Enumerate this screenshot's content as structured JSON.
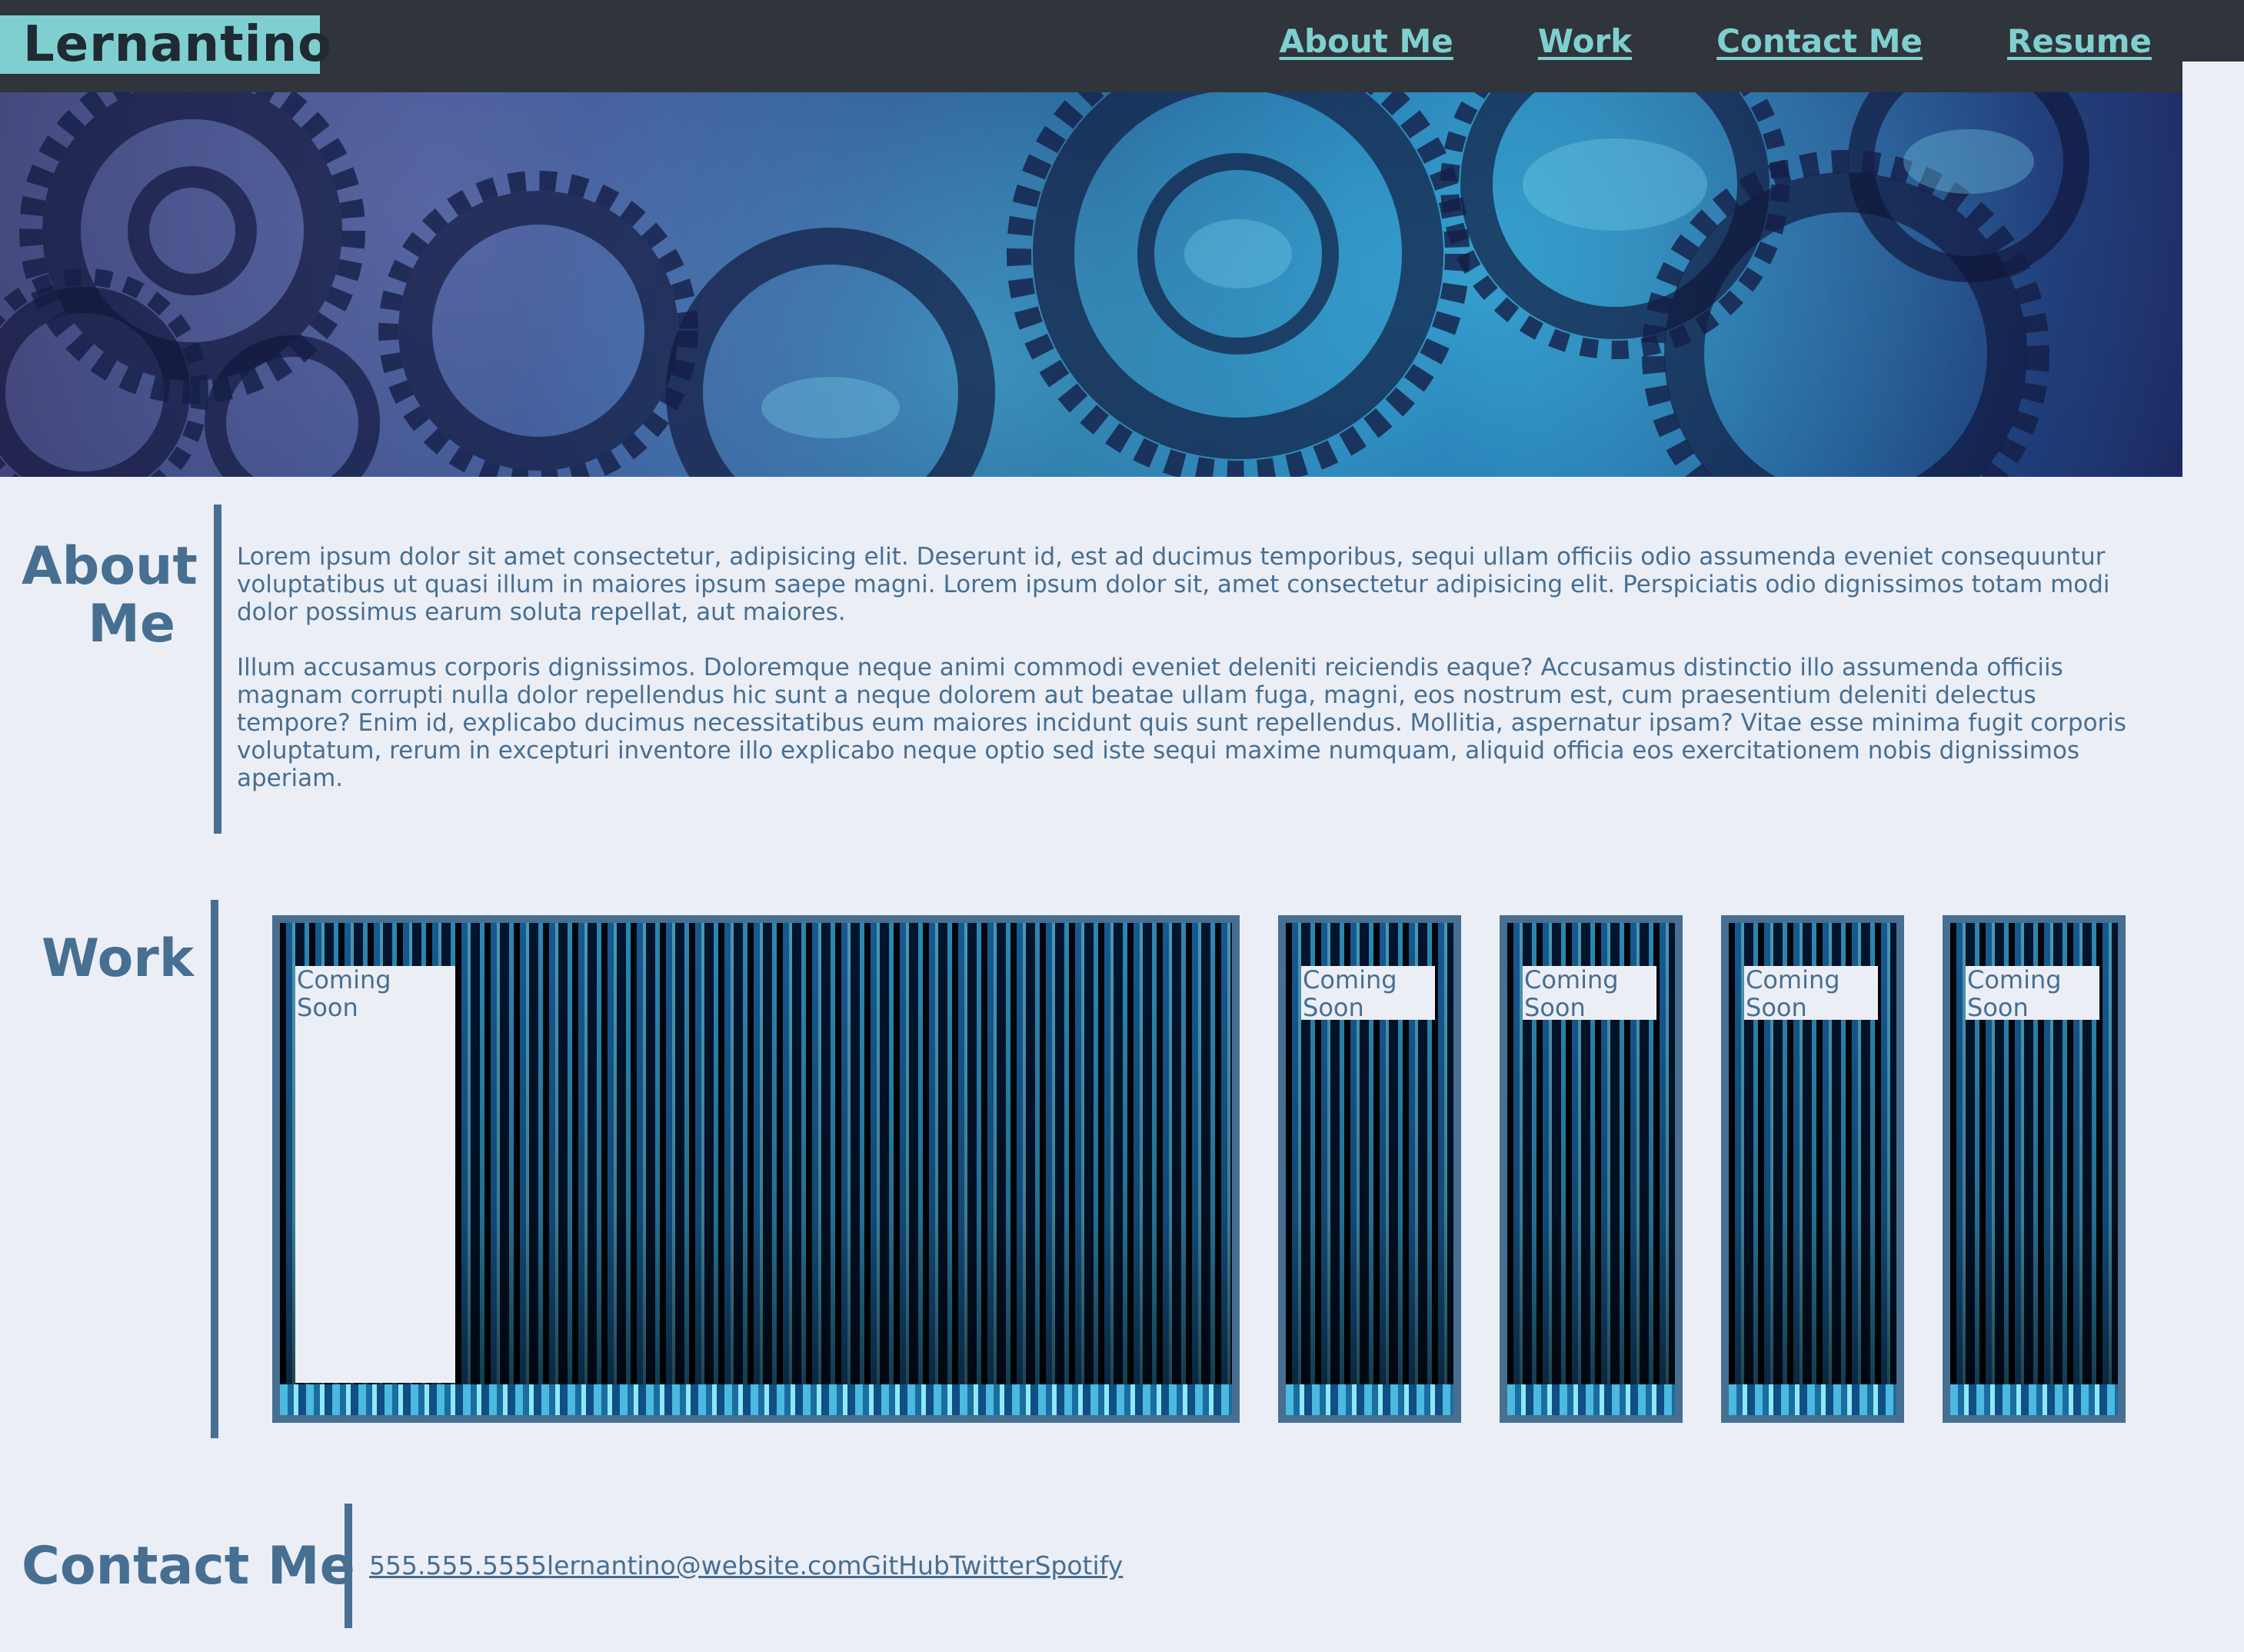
{
  "header": {
    "brand": "Lernantino",
    "nav": [
      "About Me",
      "Work",
      "Contact Me",
      "Resume"
    ]
  },
  "about": {
    "title": "About Me",
    "paragraphs": [
      "Lorem ipsum dolor sit amet consectetur, adipisicing elit. Deserunt id, est ad ducimus temporibus, sequi ullam officiis odio assumenda eveniet consequuntur voluptatibus ut quasi illum in maiores ipsum saepe magni. Lorem ipsum dolor sit, amet consectetur adipisicing elit. Perspiciatis odio dignissimos totam modi dolor possimus earum soluta repellat, aut maiores.",
      "Illum accusamus corporis dignissimos. Doloremque neque animi commodi eveniet deleniti reiciendis eaque? Accusamus distinctio illo assumenda officiis magnam corrupti nulla dolor repellendus hic sunt a neque dolorem aut beatae ullam fuga, magni, eos nostrum est, cum praesentium deleniti delectus tempore? Enim id, explicabo ducimus necessitatibus eum maiores incidunt quis sunt repellendus. Mollitia, aspernatur ipsam? Vitae esse minima fugit corporis voluptatum, rerum in excepturi inventore illo explicabo neque optio sed iste sequi maxime numquam, aliquid officia eos exercitationem nobis dignissimos aperiam."
    ]
  },
  "work": {
    "title": "Work",
    "items": [
      {
        "label": "Coming Soon"
      },
      {
        "label": "Coming Soon"
      },
      {
        "label": "Coming Soon"
      },
      {
        "label": "Coming Soon"
      },
      {
        "label": "Coming Soon"
      }
    ]
  },
  "contact": {
    "title": "Contact Me",
    "links": [
      "555.555.5555",
      "lernantino@website.com",
      "GitHub",
      "Twitter",
      "Spotify"
    ]
  },
  "colors": {
    "background": "#eceef6",
    "nav": "#30343b",
    "accent": "#7fcfd0",
    "primary": "#466f92"
  }
}
